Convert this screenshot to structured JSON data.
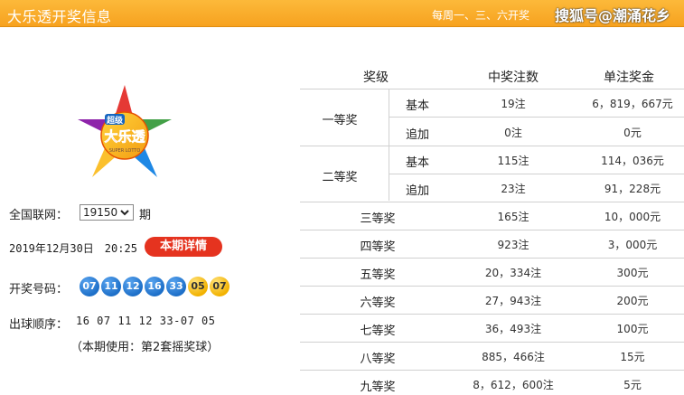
{
  "header": {
    "title": "大乐透开奖信息",
    "schedule": "每周一、三、六开奖",
    "watermark": "搜狐号@潮涌花乡"
  },
  "logo": {
    "top_text": "超级",
    "main_text": "大乐透",
    "sub_text": "SUPER LOTTO"
  },
  "info": {
    "network_label": "全国联网：",
    "period_value": "19150",
    "period_suffix": "期",
    "date_time": "2019年12月30日　20:25",
    "detail_button": "本期详情",
    "balls_label": "开奖号码：",
    "balls": [
      {
        "value": "07",
        "color": "blue"
      },
      {
        "value": "11",
        "color": "blue"
      },
      {
        "value": "12",
        "color": "blue"
      },
      {
        "value": "16",
        "color": "blue"
      },
      {
        "value": "33",
        "color": "blue"
      },
      {
        "value": "05",
        "color": "yellow"
      },
      {
        "value": "07",
        "color": "yellow"
      }
    ],
    "order_label": "出球顺序：",
    "order_value": "16 07 11 12 33-07 05",
    "ballset_note": "（本期使用：第2套摇奖球）"
  },
  "table": {
    "headers": [
      "奖级",
      "中奖注数",
      "单注奖金"
    ],
    "rows": [
      {
        "level": "一等奖",
        "sub": "基本",
        "count": "19注",
        "amount": "6，819，667元"
      },
      {
        "level": "",
        "sub": "追加",
        "count": "0注",
        "amount": "0元"
      },
      {
        "level": "二等奖",
        "sub": "基本",
        "count": "115注",
        "amount": "114，036元"
      },
      {
        "level": "",
        "sub": "追加",
        "count": "23注",
        "amount": "91，228元"
      },
      {
        "level": "三等奖",
        "sub": "",
        "count": "165注",
        "amount": "10，000元"
      },
      {
        "level": "四等奖",
        "sub": "",
        "count": "923注",
        "amount": "3，000元"
      },
      {
        "level": "五等奖",
        "sub": "",
        "count": "20，334注",
        "amount": "300元"
      },
      {
        "level": "六等奖",
        "sub": "",
        "count": "27，943注",
        "amount": "200元"
      },
      {
        "level": "七等奖",
        "sub": "",
        "count": "36，493注",
        "amount": "100元"
      },
      {
        "level": "八等奖",
        "sub": "",
        "count": "885，466注",
        "amount": "15元"
      },
      {
        "level": "九等奖",
        "sub": "",
        "count": "8，612，600注",
        "amount": "5元"
      }
    ]
  },
  "colors": {
    "header_bg": "#f7a21f",
    "button_red": "#e5331f",
    "ball_blue": "#1d6fc8",
    "ball_yellow": "#f2b200"
  }
}
